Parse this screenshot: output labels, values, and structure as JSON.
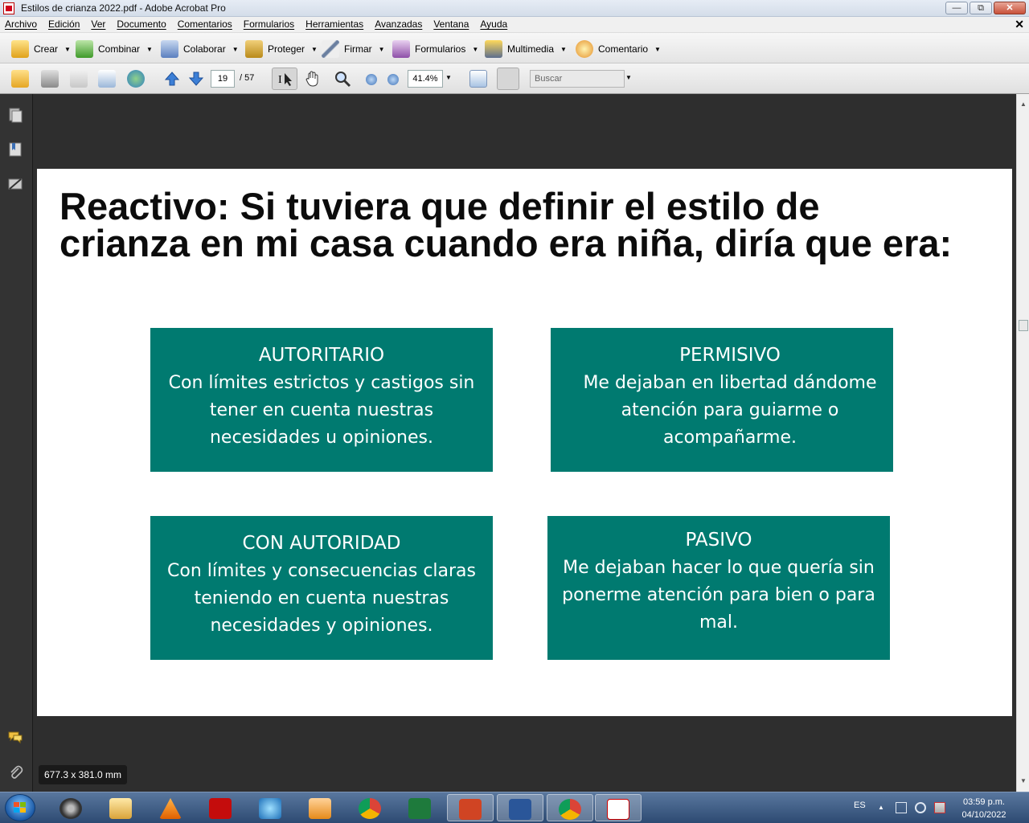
{
  "window": {
    "title": "Estilos de crianza 2022.pdf - Adobe Acrobat Pro"
  },
  "menu": [
    "Archivo",
    "Edición",
    "Ver",
    "Documento",
    "Comentarios",
    "Formularios",
    "Herramientas",
    "Avanzadas",
    "Ventana",
    "Ayuda"
  ],
  "tasks": {
    "crear": "Crear",
    "combinar": "Combinar",
    "colaborar": "Colaborar",
    "proteger": "Proteger",
    "firmar": "Firmar",
    "formularios": "Formularios",
    "multimedia": "Multimedia",
    "comentario": "Comentario"
  },
  "nav": {
    "page_current": "19",
    "page_total": "/ 57",
    "zoom": "41.4%",
    "search_placeholder": "Buscar"
  },
  "document": {
    "heading": "Reactivo: Si tuviera que definir el estilo de crianza en mi casa cuando era niña, diría que era:",
    "cards": [
      {
        "title": "AUTORITARIO",
        "desc": "Con límites estrictos y castigos sin tener en cuenta nuestras necesidades u opiniones."
      },
      {
        "title": "PERMISIVO",
        "desc": "Me dejaban en libertad dándome atención para guiarme o acompañarme."
      },
      {
        "title": "CON AUTORIDAD",
        "desc": "Con límites y consecuencias claras teniendo en cuenta nuestras necesidades y opiniones."
      },
      {
        "title": "PASIVO",
        "desc": "Me dejaban hacer lo que quería sin ponerme atención para bien o para mal."
      }
    ],
    "page_size": "677.3 x 381.0 mm"
  },
  "taskbar": {
    "lang": "ES",
    "time": "03:59 p.m.",
    "date": "04/10/2022"
  },
  "colors": {
    "card_bg": "#007a70",
    "doc_bg": "#2e2e2e"
  }
}
